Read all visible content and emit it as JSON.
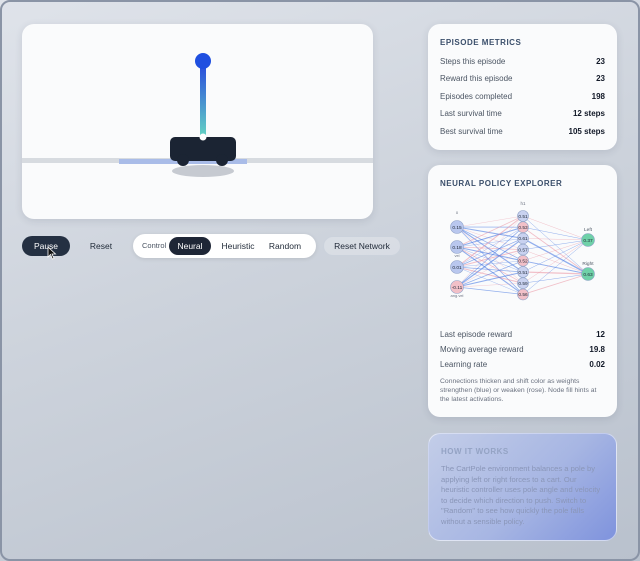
{
  "controls": {
    "pause_label": "Pause",
    "reset_label": "Reset",
    "control_label": "Control",
    "modes": [
      "Neural",
      "Heuristic",
      "Random"
    ],
    "active_mode": "Neural",
    "reset_network_label": "Reset Network"
  },
  "metrics": {
    "title": "EPISODE METRICS",
    "rows": [
      {
        "label": "Steps this episode",
        "value": "23"
      },
      {
        "label": "Reward this episode",
        "value": "23"
      },
      {
        "label": "Episodes completed",
        "value": "198"
      },
      {
        "label": "Last survival time",
        "value": "12 steps"
      },
      {
        "label": "Best survival time",
        "value": "105 steps"
      }
    ]
  },
  "neural": {
    "title": "NEURAL POLICY EXPLORER",
    "network": {
      "input_header": "x",
      "hidden_header": "h1",
      "input_labels": [
        "",
        "vel",
        "",
        "ang.vel"
      ],
      "input_values": [
        "0.15",
        "0.18",
        "0.01",
        "-0.11"
      ],
      "hidden_values": [
        "0.51",
        "0.53",
        "0.61",
        "0.57",
        "0.52",
        "0.51",
        "0.59",
        "0.56"
      ],
      "output_labels": [
        "Left",
        "Right"
      ],
      "output_values": [
        "0.37",
        "0.63"
      ]
    },
    "stats": [
      {
        "label": "Last episode reward",
        "value": "12"
      },
      {
        "label": "Moving average reward",
        "value": "19.8"
      },
      {
        "label": "Learning rate",
        "value": "0.02"
      }
    ],
    "note": "Connections thicken and shift color as weights strengthen (blue) or weaken (rose). Node fill hints at the latest activations."
  },
  "how": {
    "title": "HOW IT WORKS",
    "text": "The CartPole environment balances a pole by applying left or right forces to a cart. Our heuristic controller uses pole angle and velocity to decide which direction to push. Switch to \"Random\" to see how quickly the pole falls without a sensible policy."
  },
  "colors": {
    "accent_dark": "#1e2636",
    "weight_positive": "#3b6fe0",
    "weight_negative": "#e98f9f",
    "output_node": "#6fd1a8",
    "pole_top": "#1f4fe0",
    "pole_bottom": "#5fd0c2"
  },
  "icons": [
    "cursor-arrow-icon"
  ]
}
